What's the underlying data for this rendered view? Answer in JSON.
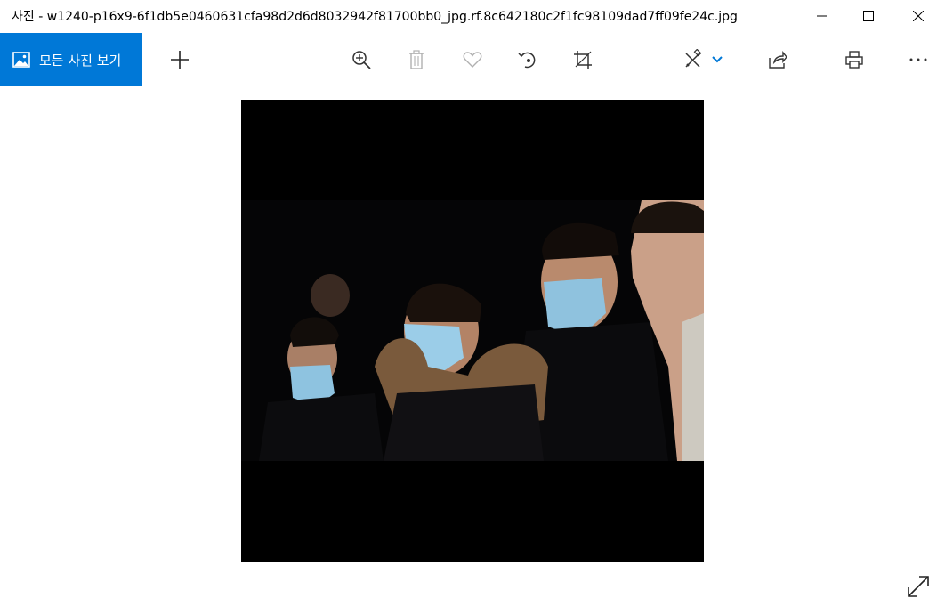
{
  "window": {
    "title": "사진 - w1240-p16x9-6f1db5e0460631cfa98d2d6d8032942f81700bb0_jpg.rf.8c642180c2f1fc98109dad7ff09fe24c.jpg"
  },
  "toolbar": {
    "all_photos_label": "모든 사진 보기"
  },
  "colors": {
    "accent": "#0078d7",
    "disabled_icon": "#b0b0b0",
    "icon": "#333333"
  }
}
